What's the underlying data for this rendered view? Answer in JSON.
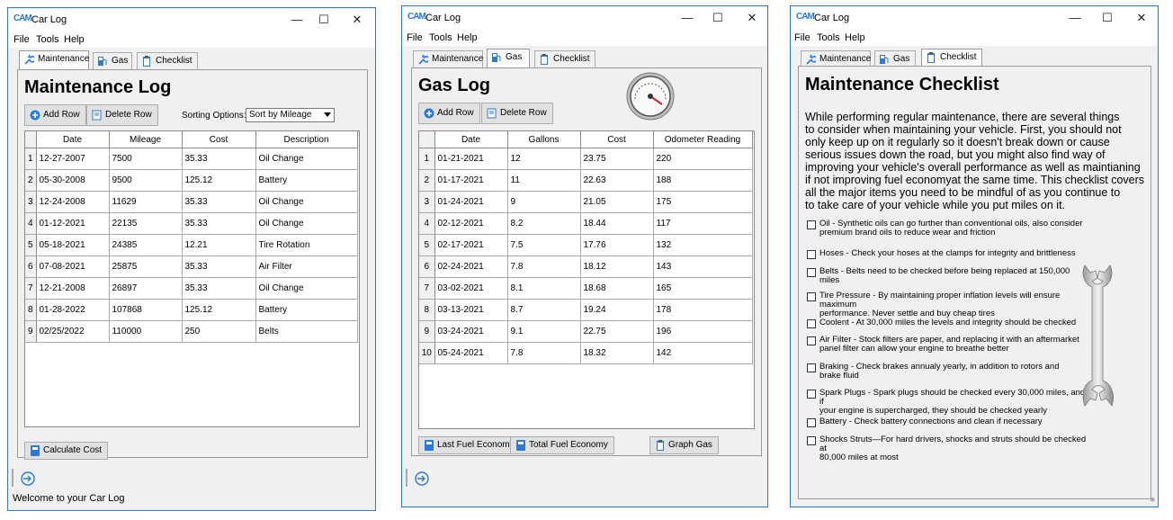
{
  "app": {
    "icon_text": "CAM",
    "title": "Car Log"
  },
  "menu": [
    "File",
    "Tools",
    "Help"
  ],
  "tabs": [
    "Maintenance",
    "Gas",
    "Checklist"
  ],
  "maintenance": {
    "heading": "Maintenance Log",
    "add_row": "Add Row",
    "delete_row": "Delete Row",
    "sorting_label": "Sorting Options:",
    "sort_value": "Sort by Mileage",
    "columns": [
      "Date",
      "Mileage",
      "Cost",
      "Description"
    ],
    "rows": [
      [
        "1",
        "12-27-2007",
        "7500",
        "35.33",
        "Oil Change"
      ],
      [
        "2",
        "05-30-2008",
        "9500",
        "125.12",
        "Battery"
      ],
      [
        "3",
        "12-24-2008",
        "11629",
        "35.33",
        "Oil Change"
      ],
      [
        "4",
        "01-12-2021",
        "22135",
        "35.33",
        "Oil Change"
      ],
      [
        "5",
        "05-18-2021",
        "24385",
        "12.21",
        "Tire Rotation"
      ],
      [
        "6",
        "07-08-2021",
        "25875",
        "35.33",
        "Air Filter"
      ],
      [
        "7",
        "12-21-2008",
        "26897",
        "35.33",
        "Oil Change"
      ],
      [
        "8",
        "01-28-2022",
        "107868",
        "125.12",
        "Battery"
      ],
      [
        "9",
        "02/25/2022",
        "110000",
        "250",
        "Belts"
      ]
    ],
    "calc_button": "Calculate Cost",
    "status": "Welcome to your Car Log"
  },
  "gas": {
    "heading": "Gas Log",
    "add_row": "Add Row",
    "delete_row": "Delete Row",
    "columns": [
      "Date",
      "Gallons",
      "Cost",
      "Odometer Reading"
    ],
    "rows": [
      [
        "1",
        "01-21-2021",
        "12",
        "23.75",
        "220"
      ],
      [
        "2",
        "01-17-2021",
        "11",
        "22.63",
        "188"
      ],
      [
        "3",
        "01-24-2021",
        "9",
        "21.05",
        "175"
      ],
      [
        "4",
        "02-12-2021",
        "8.2",
        "18.44",
        "117"
      ],
      [
        "5",
        "02-17-2021",
        "7.5",
        "17.76",
        "132"
      ],
      [
        "6",
        "02-24-2021",
        "7.8",
        "18.12",
        "143"
      ],
      [
        "7",
        "03-02-2021",
        "8.1",
        "18.68",
        "165"
      ],
      [
        "8",
        "03-13-2021",
        "8.7",
        "19.24",
        "178"
      ],
      [
        "9",
        "03-24-2021",
        "9.1",
        "22.75",
        "196"
      ],
      [
        "10",
        "05-24-2021",
        "7.8",
        "18.32",
        "142"
      ]
    ],
    "last_fuel_button": "Last Fuel Economy",
    "total_fuel_button": "Total Fuel Economy",
    "graph_button": "Graph Gas"
  },
  "checklist": {
    "heading": "Maintenance Checklist",
    "intro": [
      "While performing regular maintenance, there are several things",
      "to consider when maintaining your vehicle. First, you should not",
      "only keep up on it regularly so it doesn't break down or cause",
      "serious issues down the road, but you might also find way of",
      "improving your vehicle's overall performance as well as maintianing",
      "if not improving fuel economyat the same time. This checklist covers",
      "all the major items you need to be mindful of as you continue to",
      "to take care of your vehicle while you put miles on it."
    ],
    "items": [
      [
        "Oil - Synthetic oils can go further than conventional oils, also consider",
        "premium brand oils to reduce wear and friction"
      ],
      [
        "Hoses -  Check your hoses at the clamps for integrity and brittleness"
      ],
      [
        "Belts - Belts need to be checked before being replaced at 150,000 miles"
      ],
      [
        "Tire Pressure - By maintaining proper inflation levels will ensure maximum",
        "performance. Never settle and buy cheap tires"
      ],
      [
        "Coolent - At 30,000 miles the levels and integrity should be checked"
      ],
      [
        "Air Filter - Stock filters are paper, and replacing it with an aftermarket",
        "panel filter can allow your engine to breathe better"
      ],
      [
        "Braking - Check brakes annualy yearly, in addition to rotors and",
        "brake fluid"
      ],
      [
        "Spark Plugs - Spark plugs should be checked every 30,000 miles, and if",
        " your engine is supercharged, they should be checked yearly"
      ],
      [
        "Battery -  Check battery connections and clean if necessary"
      ],
      [
        "Shocks  Struts—For hard drivers, shocks and struts should be checked at",
        "80,000 miles at most"
      ]
    ]
  },
  "colors": {
    "accent": "#2b79d8",
    "window_bg": "#f0f0f0",
    "grid_line": "#aaaaaa"
  },
  "icons": [
    "wrench-icon",
    "gas-pump-icon",
    "clipboard-icon",
    "add-icon",
    "delete-icon",
    "calculator-icon",
    "exit-icon",
    "gauge-icon",
    "wrench-illustration"
  ]
}
